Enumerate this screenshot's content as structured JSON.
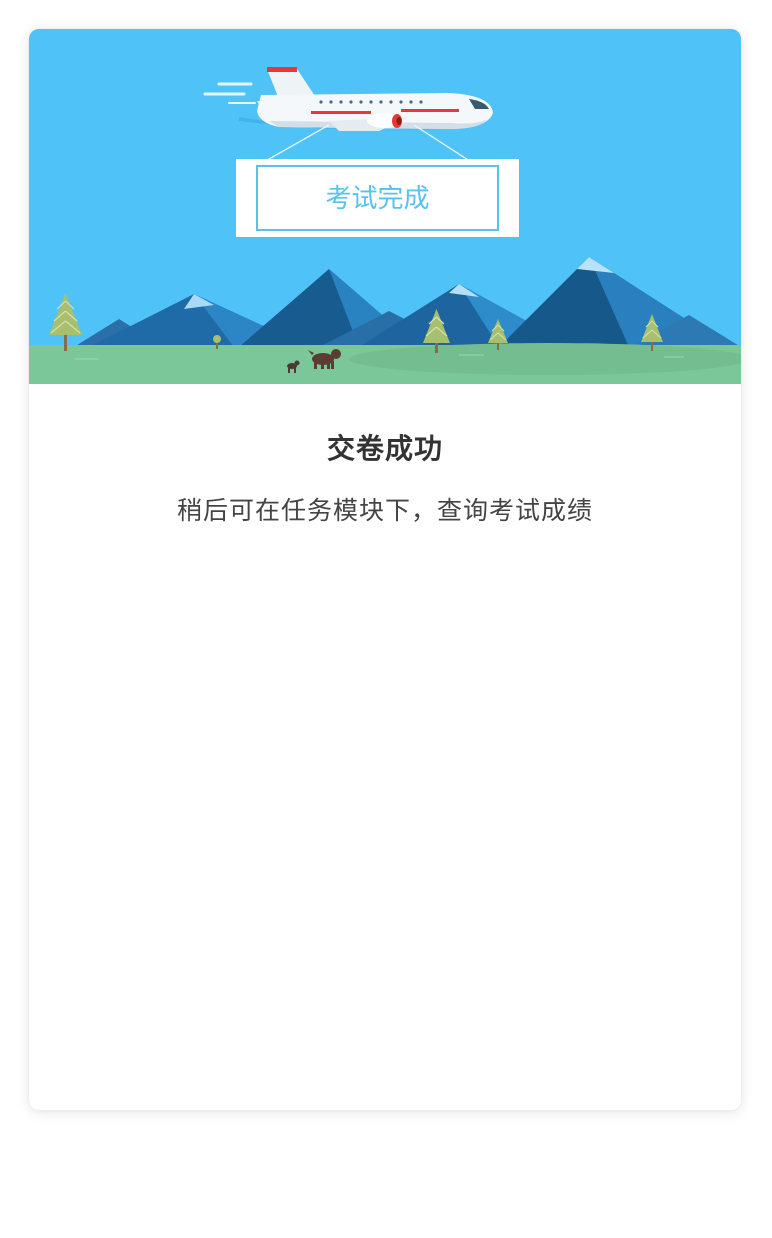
{
  "banner": {
    "sign_text": "考试完成",
    "sky_color": "#4fc3f7",
    "grass_color": "#7cc79a",
    "accent_color": "#e53935"
  },
  "result": {
    "title": "交卷成功",
    "message": "稍后可在任务模块下，查询考试成绩"
  }
}
